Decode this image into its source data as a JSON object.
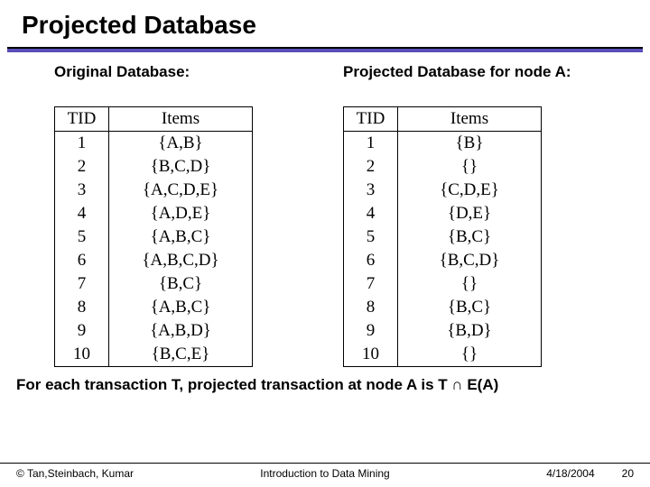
{
  "title": "Projected Database",
  "left": {
    "subtitle": "Original Database:",
    "headers": [
      "TID",
      "Items"
    ],
    "rows": [
      [
        "1",
        "{A,B}"
      ],
      [
        "2",
        "{B,C,D}"
      ],
      [
        "3",
        "{A,C,D,E}"
      ],
      [
        "4",
        "{A,D,E}"
      ],
      [
        "5",
        "{A,B,C}"
      ],
      [
        "6",
        "{A,B,C,D}"
      ],
      [
        "7",
        "{B,C}"
      ],
      [
        "8",
        "{A,B,C}"
      ],
      [
        "9",
        "{A,B,D}"
      ],
      [
        "10",
        "{B,C,E}"
      ]
    ]
  },
  "right": {
    "subtitle": "Projected Database for node A:",
    "headers": [
      "TID",
      "Items"
    ],
    "rows": [
      [
        "1",
        "{B}"
      ],
      [
        "2",
        "{}"
      ],
      [
        "3",
        "{C,D,E}"
      ],
      [
        "4",
        "{D,E}"
      ],
      [
        "5",
        "{B,C}"
      ],
      [
        "6",
        "{B,C,D}"
      ],
      [
        "7",
        "{}"
      ],
      [
        "8",
        "{B,C}"
      ],
      [
        "9",
        "{B,D}"
      ],
      [
        "10",
        "{}"
      ]
    ]
  },
  "statement_prefix": "For each transaction T, projected transaction at node A is T ",
  "statement_suffix": " E(A)",
  "footer": {
    "left": "© Tan,Steinbach, Kumar",
    "mid": "Introduction to Data Mining",
    "date": "4/18/2004",
    "page": "20"
  }
}
